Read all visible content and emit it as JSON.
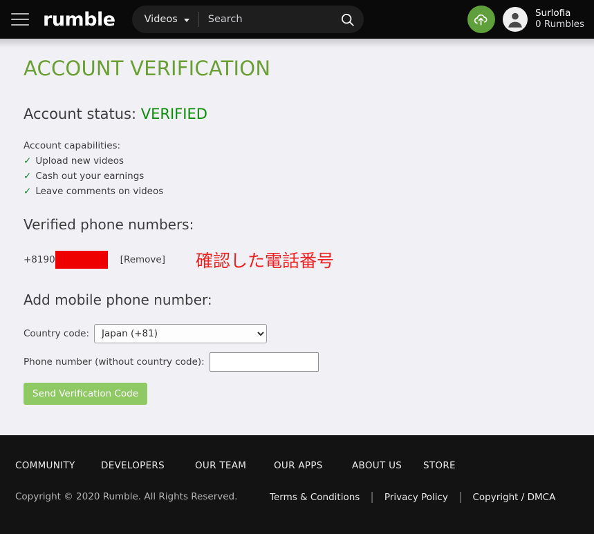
{
  "header": {
    "menu_icon": "hamburger-icon",
    "logo": "rumble",
    "search": {
      "category": "Videos",
      "placeholder": "Search",
      "value": "",
      "search_icon": "magnifier-icon",
      "chevron_icon": "chevron-down-icon"
    },
    "upload_icon": "cloud-upload-icon",
    "avatar_icon": "person-avatar-icon",
    "username": "Surlofia",
    "rumbles": "0 Rumbles"
  },
  "main": {
    "page_title": "ACCOUNT VERIFICATION",
    "account_status_label": "Account status:",
    "account_status_value": "VERIFIED",
    "capabilities_heading": "Account capabilities:",
    "capabilities": [
      {
        "tick": "✓",
        "label": "Upload new videos"
      },
      {
        "tick": "✓",
        "label": "Cash out your earnings"
      },
      {
        "tick": "✓",
        "label": "Leave comments on videos"
      }
    ],
    "verified_heading": "Verified phone numbers:",
    "phone": {
      "prefix": "+8190",
      "redacted": true,
      "remove_label": "[Remove]",
      "annotation": "確認した電話番号"
    },
    "add_heading": "Add mobile phone number:",
    "form": {
      "country_label": "Country code:",
      "country_selected": "Japan (+81)",
      "country_options": [
        "Japan (+81)"
      ],
      "phone_label": "Phone number (without country code):",
      "phone_value": "",
      "phone_placeholder": "",
      "submit_label": "Send Verification Code"
    }
  },
  "footer": {
    "links": [
      "COMMUNITY",
      "DEVELOPERS",
      "OUR TEAM",
      "OUR APPS",
      "ABOUT US",
      "STORE"
    ],
    "copyright": "Copyright © 2020 Rumble. All Rights Reserved.",
    "legal": [
      "Terms & Conditions",
      "Privacy Policy",
      "Copyright / DMCA"
    ],
    "pipe": "|"
  },
  "colors": {
    "header_bg": "#0a0a0a",
    "page_bg": "#f1f1f5",
    "title_green": "#6a9f33",
    "verified_green": "#0a8b0a",
    "button_green": "#8ec964",
    "upload_green": "#5fa03c",
    "redaction_red": "#ee0000",
    "annotation_red": "#ee2222",
    "footer_bg": "#131313"
  }
}
